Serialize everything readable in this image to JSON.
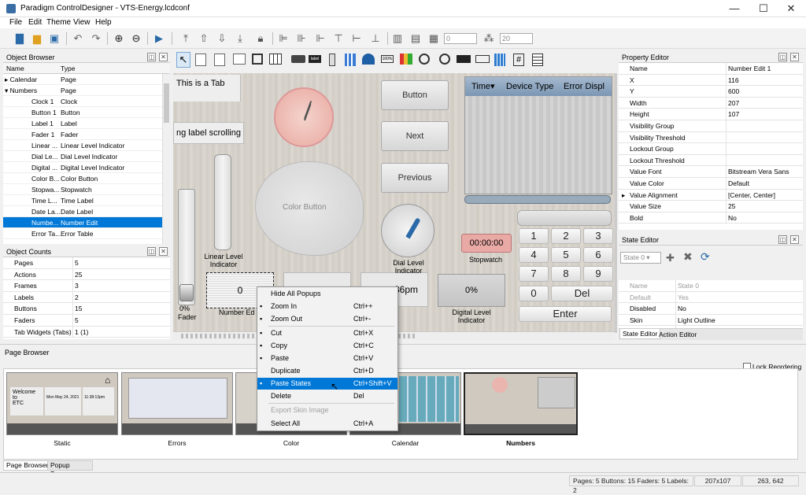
{
  "window": {
    "title": "Paradigm ControlDesigner - VTS-Energy.lcdconf",
    "minimize": "—",
    "maximize": "☐",
    "close": "✕"
  },
  "menu": [
    "File",
    "Edit",
    "Theme",
    "View",
    "Help"
  ],
  "toolbar": {
    "spin1": "0",
    "spin2": "20"
  },
  "object_browser": {
    "title": "Object Browser",
    "col_name": "Name",
    "col_type": "Type",
    "rows": [
      {
        "name": "Calendar",
        "type": "Page"
      },
      {
        "name": "Numbers",
        "type": "Page"
      },
      {
        "name": "Clock 1",
        "type": "Clock"
      },
      {
        "name": "Button 1",
        "type": "Button"
      },
      {
        "name": "Label 1",
        "type": "Label"
      },
      {
        "name": "Fader 1",
        "type": "Fader"
      },
      {
        "name": "Linear ...",
        "type": "Linear Level Indicator"
      },
      {
        "name": "Dial Le...",
        "type": "Dial Level Indicator"
      },
      {
        "name": "Digital ...",
        "type": "Digital Level Indicator"
      },
      {
        "name": "Color B...",
        "type": "Color Button"
      },
      {
        "name": "Stopwa...",
        "type": "Stopwatch"
      },
      {
        "name": "Time L...",
        "type": "Time Label"
      },
      {
        "name": "Date La...",
        "type": "Date Label"
      },
      {
        "name": "Numbe...",
        "type": "Number Edit"
      },
      {
        "name": "Error Ta...",
        "type": "Error Table"
      }
    ]
  },
  "object_counts": {
    "title": "Object Counts",
    "rows": [
      {
        "k": "Pages",
        "v": "5"
      },
      {
        "k": "Actions",
        "v": "25"
      },
      {
        "k": "Frames",
        "v": "3"
      },
      {
        "k": "Labels",
        "v": "2"
      },
      {
        "k": "Buttons",
        "v": "15"
      },
      {
        "k": "Faders",
        "v": "5"
      },
      {
        "k": "Tab Widgets (Tabs)",
        "v": "1 (1)"
      }
    ]
  },
  "property_editor": {
    "title": "Property Editor",
    "rows": [
      {
        "k": "Name",
        "v": "Number Edit 1"
      },
      {
        "k": "X",
        "v": "116"
      },
      {
        "k": "Y",
        "v": "600"
      },
      {
        "k": "Width",
        "v": "207"
      },
      {
        "k": "Height",
        "v": "107"
      },
      {
        "k": "Visibility Group",
        "v": ""
      },
      {
        "k": "Visibility Threshold",
        "v": ""
      },
      {
        "k": "Lockout Group",
        "v": ""
      },
      {
        "k": "Lockout Threshold",
        "v": ""
      },
      {
        "k": "Value Font",
        "v": "Bitstream Vera Sans"
      },
      {
        "k": "Value Color",
        "v": "Default"
      },
      {
        "k": "Value Alignment",
        "v": "[Center, Center]"
      },
      {
        "k": "Value Size",
        "v": "25"
      },
      {
        "k": "Bold",
        "v": "No"
      }
    ]
  },
  "state_editor": {
    "title": "State Editor",
    "combo": "State 0",
    "rows": [
      {
        "k": "Name",
        "v": "State 0",
        "dim": true
      },
      {
        "k": "Default",
        "v": "Yes",
        "dim": true
      },
      {
        "k": "Disabled",
        "v": "No",
        "dim": false
      },
      {
        "k": "Skin",
        "v": "Light Outline",
        "dim": false
      },
      {
        "k": "Color",
        "v": "Default",
        "dim": false
      }
    ],
    "tab1": "State Editor",
    "tab2": "Action Editor"
  },
  "canvas": {
    "tab_label": "This is a Tab",
    "scroll_label": "ng label scrolling",
    "button": "Button",
    "next": "Next",
    "previous": "Previous",
    "color_button": "Color Button",
    "linear_label": "Linear Level\nIndicator",
    "fader_value": "0%",
    "fader_label": "Fader",
    "number_value": "0",
    "number_label": "Number Ed",
    "time_value": "36pm",
    "dial_label": "Dial Level\nIndicator",
    "digital_value": "0%",
    "digital_label": "Digital Level\nIndicator",
    "stopwatch_value": "00:00:00",
    "stopwatch_label": "Stopwatch",
    "table_headers": [
      "Time▾",
      "Device Type",
      "Error Displ"
    ],
    "keys": [
      "1",
      "2",
      "3",
      "4",
      "5",
      "6",
      "7",
      "8",
      "9",
      "0",
      "Del"
    ],
    "enter": "Enter"
  },
  "context_menu": {
    "items": [
      {
        "label": "Hide All Popups",
        "shortcut": "",
        "disabled": false,
        "highlight": false,
        "icon": ""
      },
      {
        "label": "Zoom In",
        "shortcut": "Ctrl++",
        "disabled": false,
        "highlight": false,
        "icon": "zoom-in-icon"
      },
      {
        "label": "Zoom Out",
        "shortcut": "Ctrl+-",
        "disabled": false,
        "highlight": false,
        "icon": "zoom-out-icon"
      },
      {
        "label": "Cut",
        "shortcut": "Ctrl+X",
        "disabled": false,
        "highlight": false,
        "icon": "cut-icon"
      },
      {
        "label": "Copy",
        "shortcut": "Ctrl+C",
        "disabled": false,
        "highlight": false,
        "icon": "copy-icon"
      },
      {
        "label": "Paste",
        "shortcut": "Ctrl+V",
        "disabled": false,
        "highlight": false,
        "icon": "paste-icon"
      },
      {
        "label": "Duplicate",
        "shortcut": "Ctrl+D",
        "disabled": false,
        "highlight": false,
        "icon": ""
      },
      {
        "label": "Paste States",
        "shortcut": "Ctrl+Shift+V",
        "disabled": false,
        "highlight": true,
        "icon": "paste-icon"
      },
      {
        "label": "Delete",
        "shortcut": "Del",
        "disabled": false,
        "highlight": false,
        "icon": ""
      },
      {
        "label": "Export Skin Image",
        "shortcut": "",
        "disabled": true,
        "highlight": false,
        "icon": ""
      },
      {
        "label": "Select All",
        "shortcut": "Ctrl+A",
        "disabled": false,
        "highlight": false,
        "icon": ""
      }
    ]
  },
  "page_browser": {
    "title": "Page Browser",
    "lock_label": "Lock Reordering",
    "pages": [
      "Static",
      "Errors",
      "Color",
      "Calendar",
      "Numbers"
    ],
    "static_thumb_text": "Welcome to\nETC",
    "static_thumb_date": "Mon May 24, 2021",
    "static_thumb_time": "11:38:13pm",
    "tabs": [
      "Page Browser",
      "Popup Browser"
    ]
  },
  "status": {
    "counts": "Pages: 5 Buttons: 15 Faders: 5 Labels: 2",
    "size": "207x107",
    "pos": "263, 642"
  },
  "colors": {
    "accent": "#0078d7"
  }
}
